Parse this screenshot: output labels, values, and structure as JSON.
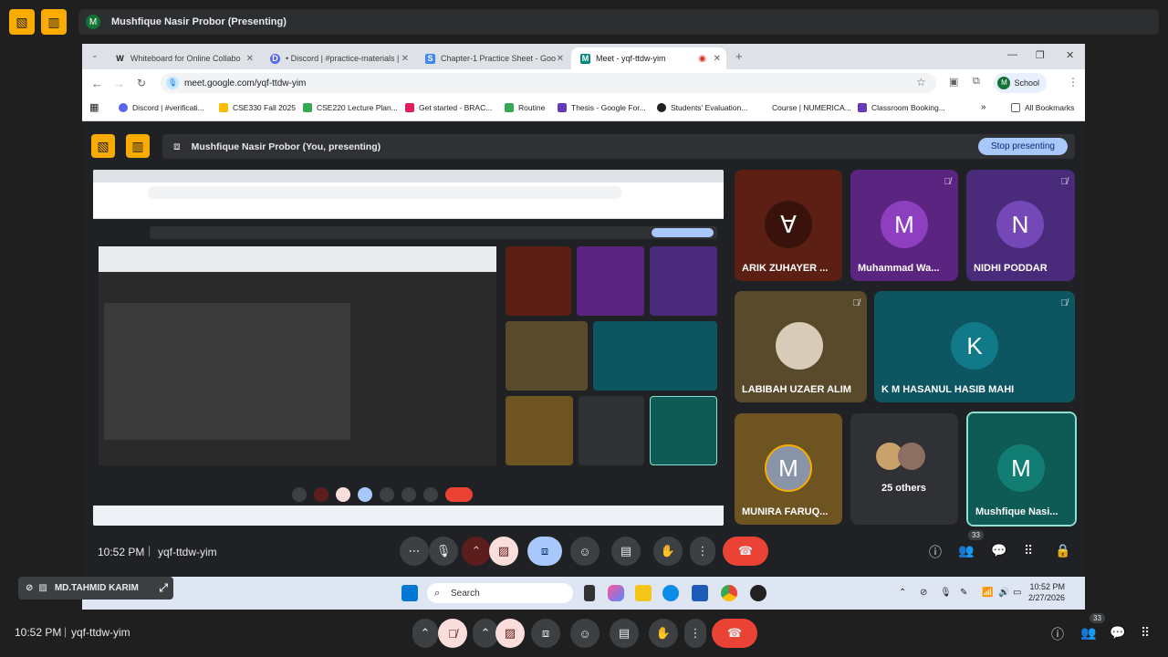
{
  "outer": {
    "banner_title": "Mushfique Nasir Probor (Presenting)",
    "avatar_letter": "M",
    "time": "10:52 PM",
    "meeting_code": "yqf-ttdw-yim",
    "participant_count": "33"
  },
  "browser": {
    "tabs": [
      {
        "label": "Whiteboard for Online Collabo",
        "icon": "W"
      },
      {
        "label": "• Discord | #practice-materials |",
        "icon": "D"
      },
      {
        "label": "Chapter-1 Practice Sheet - Goo",
        "icon": "S"
      },
      {
        "label": "Meet - yqf-ttdw-yim",
        "icon": "M"
      }
    ],
    "url": "meet.google.com/yqf-ttdw-yim",
    "profile_label": "School",
    "profile_letter": "M",
    "bookmarks": [
      "Discord | #verificati...",
      "CSE330 Fall 2025",
      "CSE220 Lecture Plan...",
      "Get started - BRAC...",
      "Routine",
      "Thesis - Google For...",
      "Students' Evaluation...",
      "Course | NUMERICA...",
      "Classroom Booking...",
      "All Bookmarks"
    ]
  },
  "meet": {
    "banner_title": "Mushfique Nasir Probor (You, presenting)",
    "stop_label": "Stop presenting",
    "time": "10:52 PM",
    "meeting_code": "yqf-ttdw-yim",
    "participant_count": "33",
    "tiles": [
      {
        "name": "ARIK ZUHAYER ...",
        "letter": "∀",
        "bg": "#5c1f14",
        "av": "#3a120c"
      },
      {
        "name": "Muhammad Wa...",
        "letter": "M",
        "bg": "#5b2480",
        "av": "#8e3fbf"
      },
      {
        "name": "NIDHI PODDAR",
        "letter": "N",
        "bg": "#4a2a7a",
        "av": "#7548b8"
      },
      {
        "name": "LABIBAH UZAER ALIM",
        "letter": "",
        "bg": "#5a4a2c",
        "av": "#d8ccb8"
      },
      {
        "name": "K M HASANUL HASIB MAHI",
        "letter": "K",
        "bg": "#0d5560",
        "av": "#107a88"
      },
      {
        "name": "MUNIRA FARUQ...",
        "letter": "M",
        "bg": "#6e5420",
        "av": "#8a94a8"
      },
      {
        "name": "25 others",
        "letter": "",
        "bg": "#303134",
        "av": "#303134"
      },
      {
        "name": "Mushfique Nasi...",
        "letter": "M",
        "bg": "#0e5b56",
        "av": "#117d73"
      }
    ]
  },
  "taskbar": {
    "search": "Search",
    "clock_time": "10:52 PM",
    "clock_date": "2/27/2026"
  },
  "self_tile": {
    "name": "MD.TAHMID KARIM"
  }
}
